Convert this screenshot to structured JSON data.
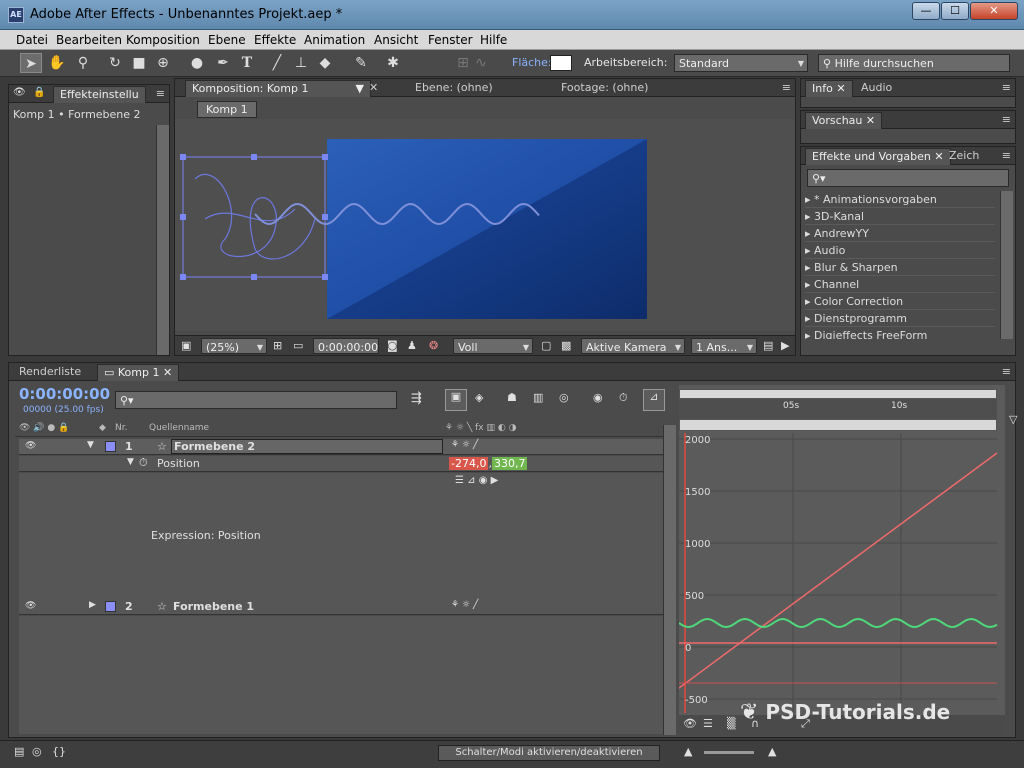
{
  "window": {
    "app_icon": "AE",
    "title": "Adobe After Effects - Unbenanntes Projekt.aep *",
    "controls": [
      "minimize-icon",
      "maximize-icon",
      "close-icon"
    ]
  },
  "menu": {
    "items": [
      "Datei",
      "Bearbeiten",
      "Komposition",
      "Ebene",
      "Effekte",
      "Animation",
      "Ansicht",
      "Fenster",
      "Hilfe"
    ]
  },
  "toolbar": {
    "tools": [
      "selection-tool-icon",
      "hand-tool-icon",
      "zoom-tool-icon",
      "rotate-tool-icon",
      "camera-tool-icon",
      "pan-behind-tool-icon",
      "shape-tool-icon",
      "pen-tool-icon",
      "type-tool-icon",
      "brush-tool-icon",
      "clone-stamp-icon",
      "eraser-icon",
      "roto-brush-icon",
      "puppet-pin-icon"
    ],
    "flaeche_label": "Fläche:",
    "arbeitsbereich_label": "Arbeitsbereich:",
    "workspace_value": "Standard",
    "help_placeholder": "Hilfe durchsuchen"
  },
  "effect_controls": {
    "tab": "Effekteinstellu",
    "breadcrumb": "Komp 1 • Formebene 2"
  },
  "composition_panel": {
    "tabs": [
      "Komposition: Komp 1",
      "Ebene: (ohne)",
      "Footage: (ohne)"
    ],
    "sub_tab": "Komp 1",
    "zoom": "(25%)",
    "timecode": "0:00:00:00",
    "resolution": "Voll",
    "camera": "Aktive Kamera",
    "views": "1 Ans..."
  },
  "right_panels": {
    "info_tabs": [
      "Info",
      "Audio"
    ],
    "preview_tab": "Vorschau",
    "effects_tab": "Effekte und Vorgaben",
    "effects_tab2": "Zeich",
    "effects_search_icon": "search-icon",
    "effects_list": [
      "* Animationsvorgaben",
      "3D-Kanal",
      "AndrewYY",
      "Audio",
      "Blur & Sharpen",
      "Channel",
      "Color Correction",
      "Dienstprogramm",
      "Digieffects FreeForm"
    ]
  },
  "timeline": {
    "tabs": [
      "Renderliste",
      "Komp 1"
    ],
    "timecode": "0:00:00:00",
    "fps": "00000 (25.00 fps)",
    "col_nr": "Nr.",
    "col_source": "Quellenname",
    "layers": [
      {
        "nr": "1",
        "name": "Formebene 2"
      },
      {
        "nr": "2",
        "name": "Formebene 1"
      }
    ],
    "property": "Position",
    "pos_x": "-274,0",
    "pos_y": "330,7",
    "expression_label": "Expression: Position",
    "ruler": [
      "05s",
      "10s"
    ],
    "graph_labels": [
      "2000",
      "1500",
      "1000",
      "500",
      "0",
      "-500"
    ],
    "toggle_label": "Schalter/Modi aktivieren/deaktivieren"
  },
  "watermark": "PSD-Tutorials.de"
}
